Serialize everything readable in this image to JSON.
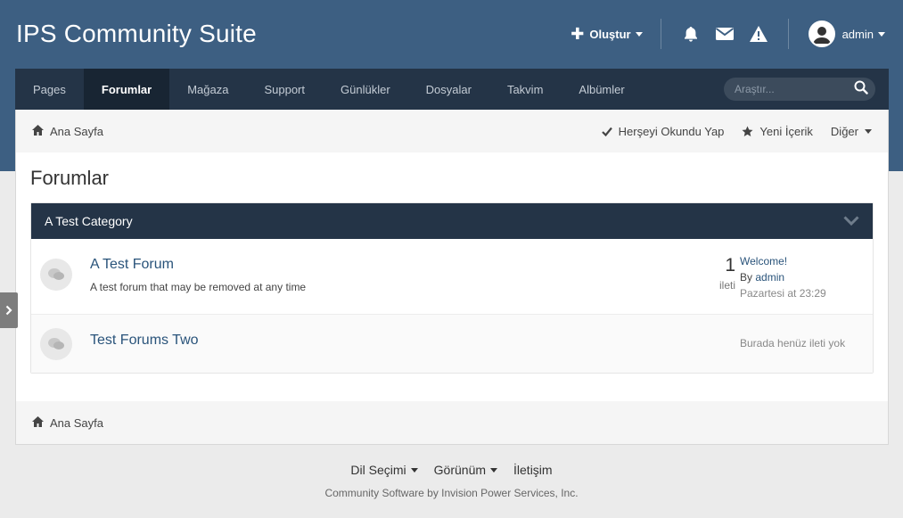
{
  "header": {
    "site_title": "IPS Community Suite",
    "create_label": "Oluştur",
    "user_name": "admin"
  },
  "nav": {
    "items": [
      {
        "label": "Pages"
      },
      {
        "label": "Forumlar",
        "active": true
      },
      {
        "label": "Mağaza"
      },
      {
        "label": "Support"
      },
      {
        "label": "Günlükler"
      },
      {
        "label": "Dosyalar"
      },
      {
        "label": "Takvim"
      },
      {
        "label": "Albümler"
      }
    ],
    "search_placeholder": "Araştır..."
  },
  "breadcrumb": {
    "home": "Ana Sayfa",
    "mark_read": "Herşeyi Okundu Yap",
    "new_content": "Yeni İçerik",
    "other": "Diğer"
  },
  "page": {
    "title": "Forumlar"
  },
  "category": {
    "title": "A Test Category",
    "forums": [
      {
        "name": "A Test Forum",
        "description": "A test forum that may be removed at any time",
        "post_count": "1",
        "post_label": "ileti",
        "last_post_title": "Welcome!",
        "last_post_by": "By",
        "last_post_author": "admin",
        "last_post_date": "Pazartesi at 23:29"
      },
      {
        "name": "Test Forums Two",
        "no_posts": "Burada henüz ileti yok"
      }
    ]
  },
  "footer": {
    "language": "Dil Seçimi",
    "theme": "Görünüm",
    "contact": "İletişim",
    "copyright": "Community Software by Invision Power Services, Inc."
  },
  "colors": {
    "header_bg": "#3d5f82",
    "nav_bg": "#243447",
    "link": "#29537a"
  }
}
